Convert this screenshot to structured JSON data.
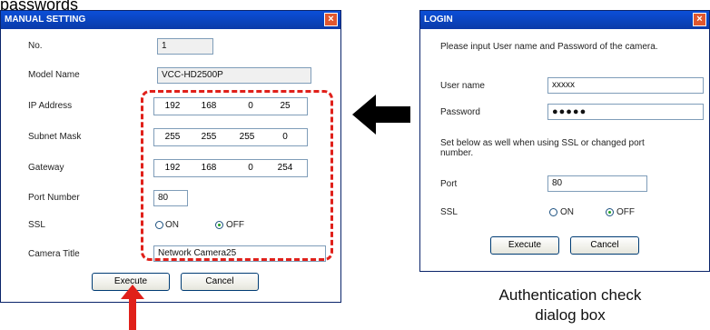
{
  "top_fragment": "passwords",
  "manual_window": {
    "title": "MANUAL SETTING",
    "close_glyph": "×",
    "labels": {
      "no": "No.",
      "model": "Model Name",
      "ip": "IP Address",
      "subnet": "Subnet Mask",
      "gateway": "Gateway",
      "port": "Port Number",
      "ssl": "SSL",
      "camera_title": "Camera Title"
    },
    "values": {
      "no": "1",
      "model": "VCC-HD2500P",
      "ip": [
        "192",
        "168",
        "0",
        "25"
      ],
      "subnet": [
        "255",
        "255",
        "255",
        "0"
      ],
      "gateway": [
        "192",
        "168",
        "0",
        "254"
      ],
      "port": "80",
      "camera_title": "Network Camera25"
    },
    "ssl_on": "ON",
    "ssl_off": "OFF",
    "ssl_selected": "OFF",
    "execute": "Execute",
    "cancel": "Cancel"
  },
  "login_window": {
    "title": "LOGIN",
    "close_glyph": "×",
    "instruction": "Please input User name and Password of the camera.",
    "user_label": "User name",
    "user_value": "xxxxx",
    "password_label": "Password",
    "password_value": "●●●●●",
    "note": "Set below as well when using SSL or changed port number.",
    "port_label": "Port",
    "port_value": "80",
    "ssl_label": "SSL",
    "ssl_on": "ON",
    "ssl_off": "OFF",
    "ssl_selected": "OFF",
    "execute": "Execute",
    "cancel": "Cancel"
  },
  "caption": {
    "line1": "Authentication check",
    "line2": "dialog box"
  },
  "colors": {
    "highlight": "#e0201a",
    "arrow": "#000000",
    "titlebar": "#0b4fd8"
  }
}
